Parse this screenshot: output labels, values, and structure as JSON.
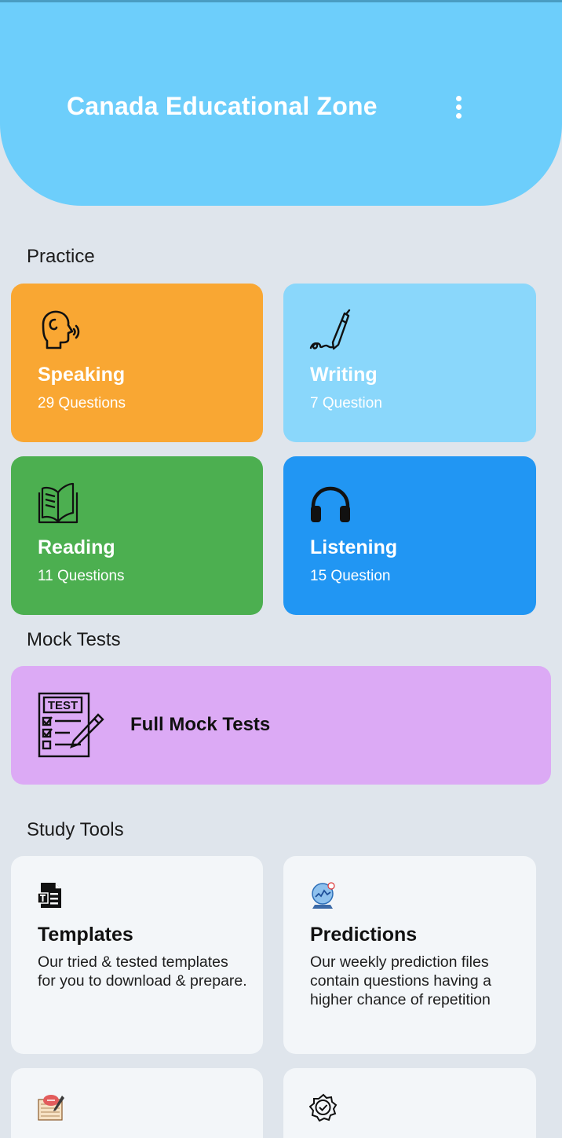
{
  "header": {
    "title": "Canada Educational Zone",
    "menu_icon": "more-vert-icon"
  },
  "sections": {
    "practice": "Practice",
    "mock": "Mock Tests",
    "tools": "Study Tools"
  },
  "practice": [
    {
      "title": "Speaking",
      "subtitle": "29 Questions",
      "icon": "speaking-head-icon",
      "color": "#f9a733"
    },
    {
      "title": "Writing",
      "subtitle": "7 Question",
      "icon": "pen-signature-icon",
      "color": "#8ad7fb"
    },
    {
      "title": "Reading",
      "subtitle": "11 Questions",
      "icon": "open-book-icon",
      "color": "#4caf50"
    },
    {
      "title": "Listening",
      "subtitle": "15 Question",
      "icon": "headphones-icon",
      "color": "#2196f3"
    }
  ],
  "mock": {
    "title": "Full Mock Tests",
    "icon": "test-sheet-icon",
    "icon_text": "TEST",
    "color": "#dcaaf5"
  },
  "tools": [
    {
      "title": "Templates",
      "description": "Our tried & tested templates for you to download & prepare.",
      "icon": "template-document-icon"
    },
    {
      "title": "Predictions",
      "description": "Our weekly prediction files contain questions having a higher chance of repetition",
      "icon": "crystal-ball-icon"
    },
    {
      "title": "",
      "description": "",
      "icon": "vocabulary-book-icon"
    },
    {
      "title": "",
      "description": "",
      "icon": "verified-badge-icon"
    }
  ],
  "colors": {
    "header": "#6dcefb",
    "background": "#dfe5ec",
    "tool_card": "#f3f6f9"
  }
}
